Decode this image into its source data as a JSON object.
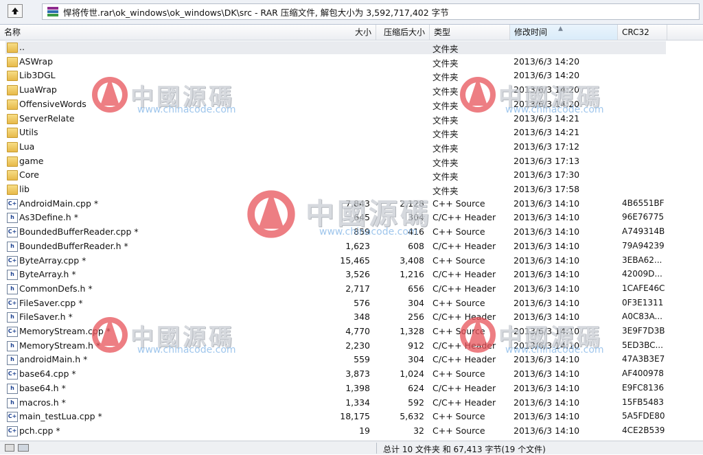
{
  "path_bar": {
    "path": "悍将传世.rar\\ok_windows\\ok_windows\\DK\\src - RAR 压缩文件, 解包大小为 3,592,717,402 字节"
  },
  "columns": {
    "name": "名称",
    "size": "大小",
    "packed": "压缩后大小",
    "type": "类型",
    "modified": "修改时间",
    "crc": "CRC32"
  },
  "rows": [
    {
      "name": "..",
      "size": "",
      "packed": "",
      "type": "文件夹",
      "modified": "",
      "crc": "",
      "kind": "folder"
    },
    {
      "name": "ASWrap",
      "size": "",
      "packed": "",
      "type": "文件夹",
      "modified": "2013/6/3 14:20",
      "crc": "",
      "kind": "folder"
    },
    {
      "name": "Lib3DGL",
      "size": "",
      "packed": "",
      "type": "文件夹",
      "modified": "2013/6/3 14:20",
      "crc": "",
      "kind": "folder"
    },
    {
      "name": "LuaWrap",
      "size": "",
      "packed": "",
      "type": "文件夹",
      "modified": "2013/6/3 14:20",
      "crc": "",
      "kind": "folder"
    },
    {
      "name": "OffensiveWords",
      "size": "",
      "packed": "",
      "type": "文件夹",
      "modified": "2013/6/3 14:20",
      "crc": "",
      "kind": "folder"
    },
    {
      "name": "ServerRelate",
      "size": "",
      "packed": "",
      "type": "文件夹",
      "modified": "2013/6/3 14:21",
      "crc": "",
      "kind": "folder"
    },
    {
      "name": "Utils",
      "size": "",
      "packed": "",
      "type": "文件夹",
      "modified": "2013/6/3 14:21",
      "crc": "",
      "kind": "folder"
    },
    {
      "name": "Lua",
      "size": "",
      "packed": "",
      "type": "文件夹",
      "modified": "2013/6/3 17:12",
      "crc": "",
      "kind": "folder"
    },
    {
      "name": "game",
      "size": "",
      "packed": "",
      "type": "文件夹",
      "modified": "2013/6/3 17:13",
      "crc": "",
      "kind": "folder"
    },
    {
      "name": "Core",
      "size": "",
      "packed": "",
      "type": "文件夹",
      "modified": "2013/6/3 17:30",
      "crc": "",
      "kind": "folder"
    },
    {
      "name": "lib",
      "size": "",
      "packed": "",
      "type": "文件夹",
      "modified": "2013/6/3 17:58",
      "crc": "",
      "kind": "folder"
    },
    {
      "name": "AndroidMain.cpp *",
      "size": "7,843",
      "packed": "2,128",
      "type": "C++ Source",
      "modified": "2013/6/3 14:10",
      "crc": "4B6551BF",
      "kind": "cpp"
    },
    {
      "name": "As3Define.h *",
      "size": "645",
      "packed": "304",
      "type": "C/C++ Header",
      "modified": "2013/6/3 14:10",
      "crc": "96E76775",
      "kind": "h"
    },
    {
      "name": "BoundedBufferReader.cpp *",
      "size": "859",
      "packed": "416",
      "type": "C++ Source",
      "modified": "2013/6/3 14:10",
      "crc": "A749314B",
      "kind": "cpp"
    },
    {
      "name": "BoundedBufferReader.h *",
      "size": "1,623",
      "packed": "608",
      "type": "C/C++ Header",
      "modified": "2013/6/3 14:10",
      "crc": "79A94239",
      "kind": "h"
    },
    {
      "name": "ByteArray.cpp *",
      "size": "15,465",
      "packed": "3,408",
      "type": "C++ Source",
      "modified": "2013/6/3 14:10",
      "crc": "3EBA62...",
      "kind": "cpp"
    },
    {
      "name": "ByteArray.h *",
      "size": "3,526",
      "packed": "1,216",
      "type": "C/C++ Header",
      "modified": "2013/6/3 14:10",
      "crc": "42009D...",
      "kind": "h"
    },
    {
      "name": "CommonDefs.h *",
      "size": "2,717",
      "packed": "656",
      "type": "C/C++ Header",
      "modified": "2013/6/3 14:10",
      "crc": "1CAFE46C",
      "kind": "h"
    },
    {
      "name": "FileSaver.cpp *",
      "size": "576",
      "packed": "304",
      "type": "C++ Source",
      "modified": "2013/6/3 14:10",
      "crc": "0F3E1311",
      "kind": "cpp"
    },
    {
      "name": "FileSaver.h *",
      "size": "348",
      "packed": "256",
      "type": "C/C++ Header",
      "modified": "2013/6/3 14:10",
      "crc": "A0C83A...",
      "kind": "h"
    },
    {
      "name": "MemoryStream.cpp *",
      "size": "4,770",
      "packed": "1,328",
      "type": "C++ Source",
      "modified": "2013/6/3 14:10",
      "crc": "3E9F7D3B",
      "kind": "cpp"
    },
    {
      "name": "MemoryStream.h *",
      "size": "2,230",
      "packed": "912",
      "type": "C/C++ Header",
      "modified": "2013/6/3 14:10",
      "crc": "5ED3BC...",
      "kind": "h"
    },
    {
      "name": "androidMain.h *",
      "size": "559",
      "packed": "304",
      "type": "C/C++ Header",
      "modified": "2013/6/3 14:10",
      "crc": "47A3B3E7",
      "kind": "h"
    },
    {
      "name": "base64.cpp *",
      "size": "3,873",
      "packed": "1,024",
      "type": "C++ Source",
      "modified": "2013/6/3 14:10",
      "crc": "AF400978",
      "kind": "cpp"
    },
    {
      "name": "base64.h *",
      "size": "1,398",
      "packed": "624",
      "type": "C/C++ Header",
      "modified": "2013/6/3 14:10",
      "crc": "E9FC8136",
      "kind": "h"
    },
    {
      "name": "macros.h *",
      "size": "1,334",
      "packed": "592",
      "type": "C/C++ Header",
      "modified": "2013/6/3 14:10",
      "crc": "15FB5483",
      "kind": "h"
    },
    {
      "name": "main_testLua.cpp *",
      "size": "18,175",
      "packed": "5,632",
      "type": "C++ Source",
      "modified": "2013/6/3 14:10",
      "crc": "5A5FDE80",
      "kind": "cpp"
    },
    {
      "name": "pch.cpp *",
      "size": "19",
      "packed": "32",
      "type": "C++ Source",
      "modified": "2013/6/3 14:10",
      "crc": "4CE2B539",
      "kind": "cpp"
    }
  ],
  "watermark": {
    "logo_text": "中國源碼",
    "url": "www.chinacode.com"
  },
  "status_bar": {
    "summary": "总计 10 文件夹 和 67,413 字节(19 个文件)"
  },
  "icons": {
    "up": "up-folder-icon",
    "archive": "rar-archive-icon",
    "folder": "folder-icon",
    "cpp": "cpp-file-icon",
    "header": "header-file-icon"
  }
}
